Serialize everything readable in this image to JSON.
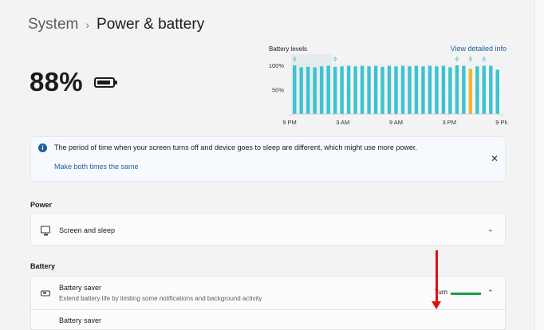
{
  "breadcrumb": {
    "parent": "System",
    "separator": "›",
    "current": "Power & battery"
  },
  "battery": {
    "percent_text": "88%",
    "level": 0.88
  },
  "chart": {
    "title": "Battery levels",
    "link": "View detailed info",
    "colors": {
      "bar": "#3cc3cf",
      "highlight_bar": "#f2b534",
      "hover_band": "#e6ecee",
      "axis": "#c8c8c8"
    }
  },
  "chart_data": {
    "type": "bar",
    "title": "Battery levels",
    "yticks": [
      "100%",
      "50%"
    ],
    "xticks": [
      "9 PM",
      "3 AM",
      "9 AM",
      "3 PM",
      "9 PM"
    ],
    "ylim": [
      0,
      100
    ],
    "values": [
      100,
      96,
      97,
      96,
      98,
      99,
      97,
      98,
      99,
      98,
      99,
      98,
      99,
      97,
      99,
      98,
      99,
      98,
      99,
      98,
      99,
      98,
      99,
      96,
      100,
      99,
      93,
      98,
      99,
      99,
      91
    ],
    "highlight_index": 26,
    "charging_marker_indices": [
      0,
      6,
      24,
      26,
      28
    ]
  },
  "info": {
    "message": "The period of time when your screen turns off and device goes to sleep are different, which might use more power.",
    "link": "Make both times the same",
    "close": "✕"
  },
  "power_section": {
    "label": "Power",
    "screen_sleep": {
      "title": "Screen and sleep",
      "chevron": "⌄"
    }
  },
  "battery_section": {
    "label": "Battery",
    "saver": {
      "title": "Battery saver",
      "subtitle": "Extend battery life by limiting some notifications and background activity",
      "status_text": "Turn",
      "chevron": "⌃"
    },
    "saver_sub": {
      "label": "Battery saver"
    }
  },
  "watermark": "https"
}
